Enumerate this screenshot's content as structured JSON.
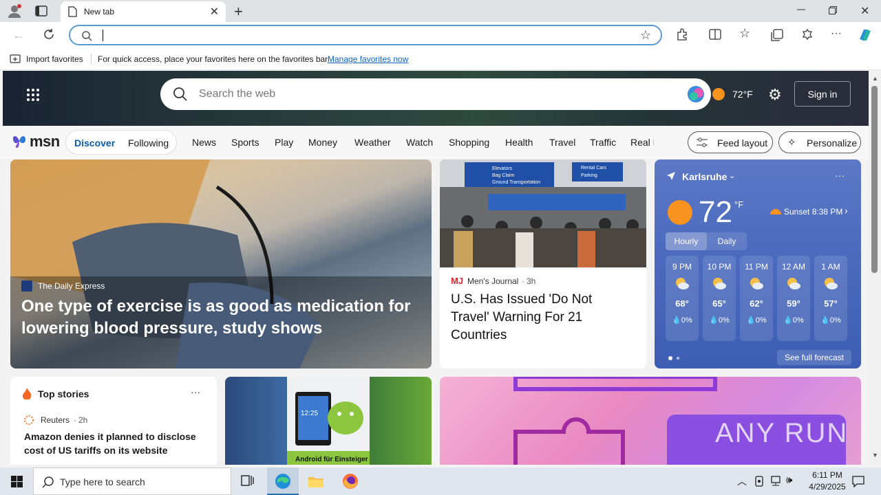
{
  "browser": {
    "tab_title": "New tab",
    "favorites_bar": {
      "import_label": "Import favorites",
      "hint": "For quick access, place your favorites here on the favorites bar.",
      "manage_link": "Manage favorites now"
    }
  },
  "msn": {
    "search_placeholder": "Search the web",
    "header_temp": "72°F",
    "sign_in": "Sign in",
    "logo_text": "msn",
    "tabs": [
      "Discover",
      "Following"
    ],
    "nav": [
      "News",
      "Sports",
      "Play",
      "Money",
      "Weather",
      "Watch",
      "Shopping",
      "Health",
      "Travel",
      "Traffic",
      "Real E"
    ],
    "feed_layout": "Feed layout",
    "personalize": "Personalize",
    "hero_story": {
      "source": "The Daily Express",
      "headline": "One type of exercise is as good as medication for lowering blood pressure, study shows"
    },
    "story2": {
      "source": "Men's Journal",
      "age": "3h",
      "headline": "U.S. Has Issued 'Do Not Travel' Warning For 21 Countries",
      "sign_lines": [
        "Elevators",
        "Bag Claim",
        "Ground Transportation",
        "Rental Cars",
        "Parking"
      ]
    },
    "weather": {
      "location": "Karlsruhe",
      "temp": "72",
      "unit": "°F",
      "sunset": "Sunset 8:38 PM",
      "tabs": [
        "Hourly",
        "Daily"
      ],
      "hours": [
        {
          "time": "9 PM",
          "temp": "68°",
          "precip": "0%"
        },
        {
          "time": "10 PM",
          "temp": "65°",
          "precip": "0%"
        },
        {
          "time": "11 PM",
          "temp": "62°",
          "precip": "0%"
        },
        {
          "time": "12 AM",
          "temp": "59°",
          "precip": "0%"
        },
        {
          "time": "1 AM",
          "temp": "57°",
          "precip": "0%"
        }
      ],
      "full_forecast": "See full forecast"
    },
    "top_stories": {
      "title": "Top stories",
      "source": "Reuters",
      "age": "2h",
      "headline": "Amazon denies it planned to disclose cost of US tariffs on its website"
    },
    "android_card": {
      "tablet_time": "12:25",
      "caption": "Android für Einsteiger"
    },
    "watermark": "ANY RUN"
  },
  "taskbar": {
    "search_placeholder": "Type here to search",
    "time": "6:11 PM",
    "date": "4/29/2025"
  }
}
